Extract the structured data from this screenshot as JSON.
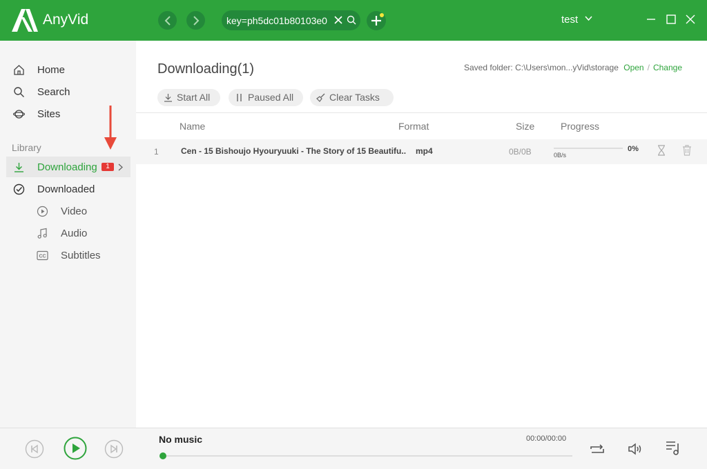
{
  "app": {
    "name": "AnyVid",
    "brand_color": "#2ea43c"
  },
  "titlebar": {
    "url": "key=ph5dc01b80103e0",
    "user": "test",
    "icons": [
      "back-icon",
      "forward-icon",
      "clear-icon",
      "search-icon",
      "add-icon",
      "minimize-icon",
      "maximize-icon",
      "close-icon"
    ]
  },
  "sidebar": {
    "items": [
      {
        "label": "Home",
        "icon": "home-icon"
      },
      {
        "label": "Search",
        "icon": "search-icon"
      },
      {
        "label": "Sites",
        "icon": "planet-icon"
      }
    ],
    "library_title": "Library",
    "library": [
      {
        "label": "Downloading",
        "icon": "download-icon",
        "badge": "1",
        "active": true
      },
      {
        "label": "Downloaded",
        "icon": "check-circle-icon"
      }
    ],
    "sub_items": [
      {
        "label": "Video",
        "icon": "play-circle-icon"
      },
      {
        "label": "Audio",
        "icon": "music-note-icon"
      },
      {
        "label": "Subtitles",
        "icon": "cc-icon"
      }
    ]
  },
  "main": {
    "title": "Downloading(1)",
    "saved_folder_label": "Saved folder:",
    "saved_folder_path": "C:\\Users\\mon...yVid\\storage",
    "open_label": "Open",
    "separator": "/",
    "change_label": "Change",
    "toolbar": {
      "start_all": "Start All",
      "paused_all": "Paused All",
      "clear_tasks": "Clear Tasks"
    },
    "columns": {
      "name": "Name",
      "format": "Format",
      "size": "Size",
      "progress": "Progress"
    },
    "rows": [
      {
        "num": "1",
        "name": "Cen - 15 Bishoujo Hyouryuuki - The Story of 15 Beautifu..",
        "format": "mp4",
        "size": "0B/0B",
        "speed": "0B/s",
        "percent": "0%",
        "progress": 0
      }
    ]
  },
  "player": {
    "title": "No music",
    "time": "00:00/00:00",
    "position": 0
  }
}
